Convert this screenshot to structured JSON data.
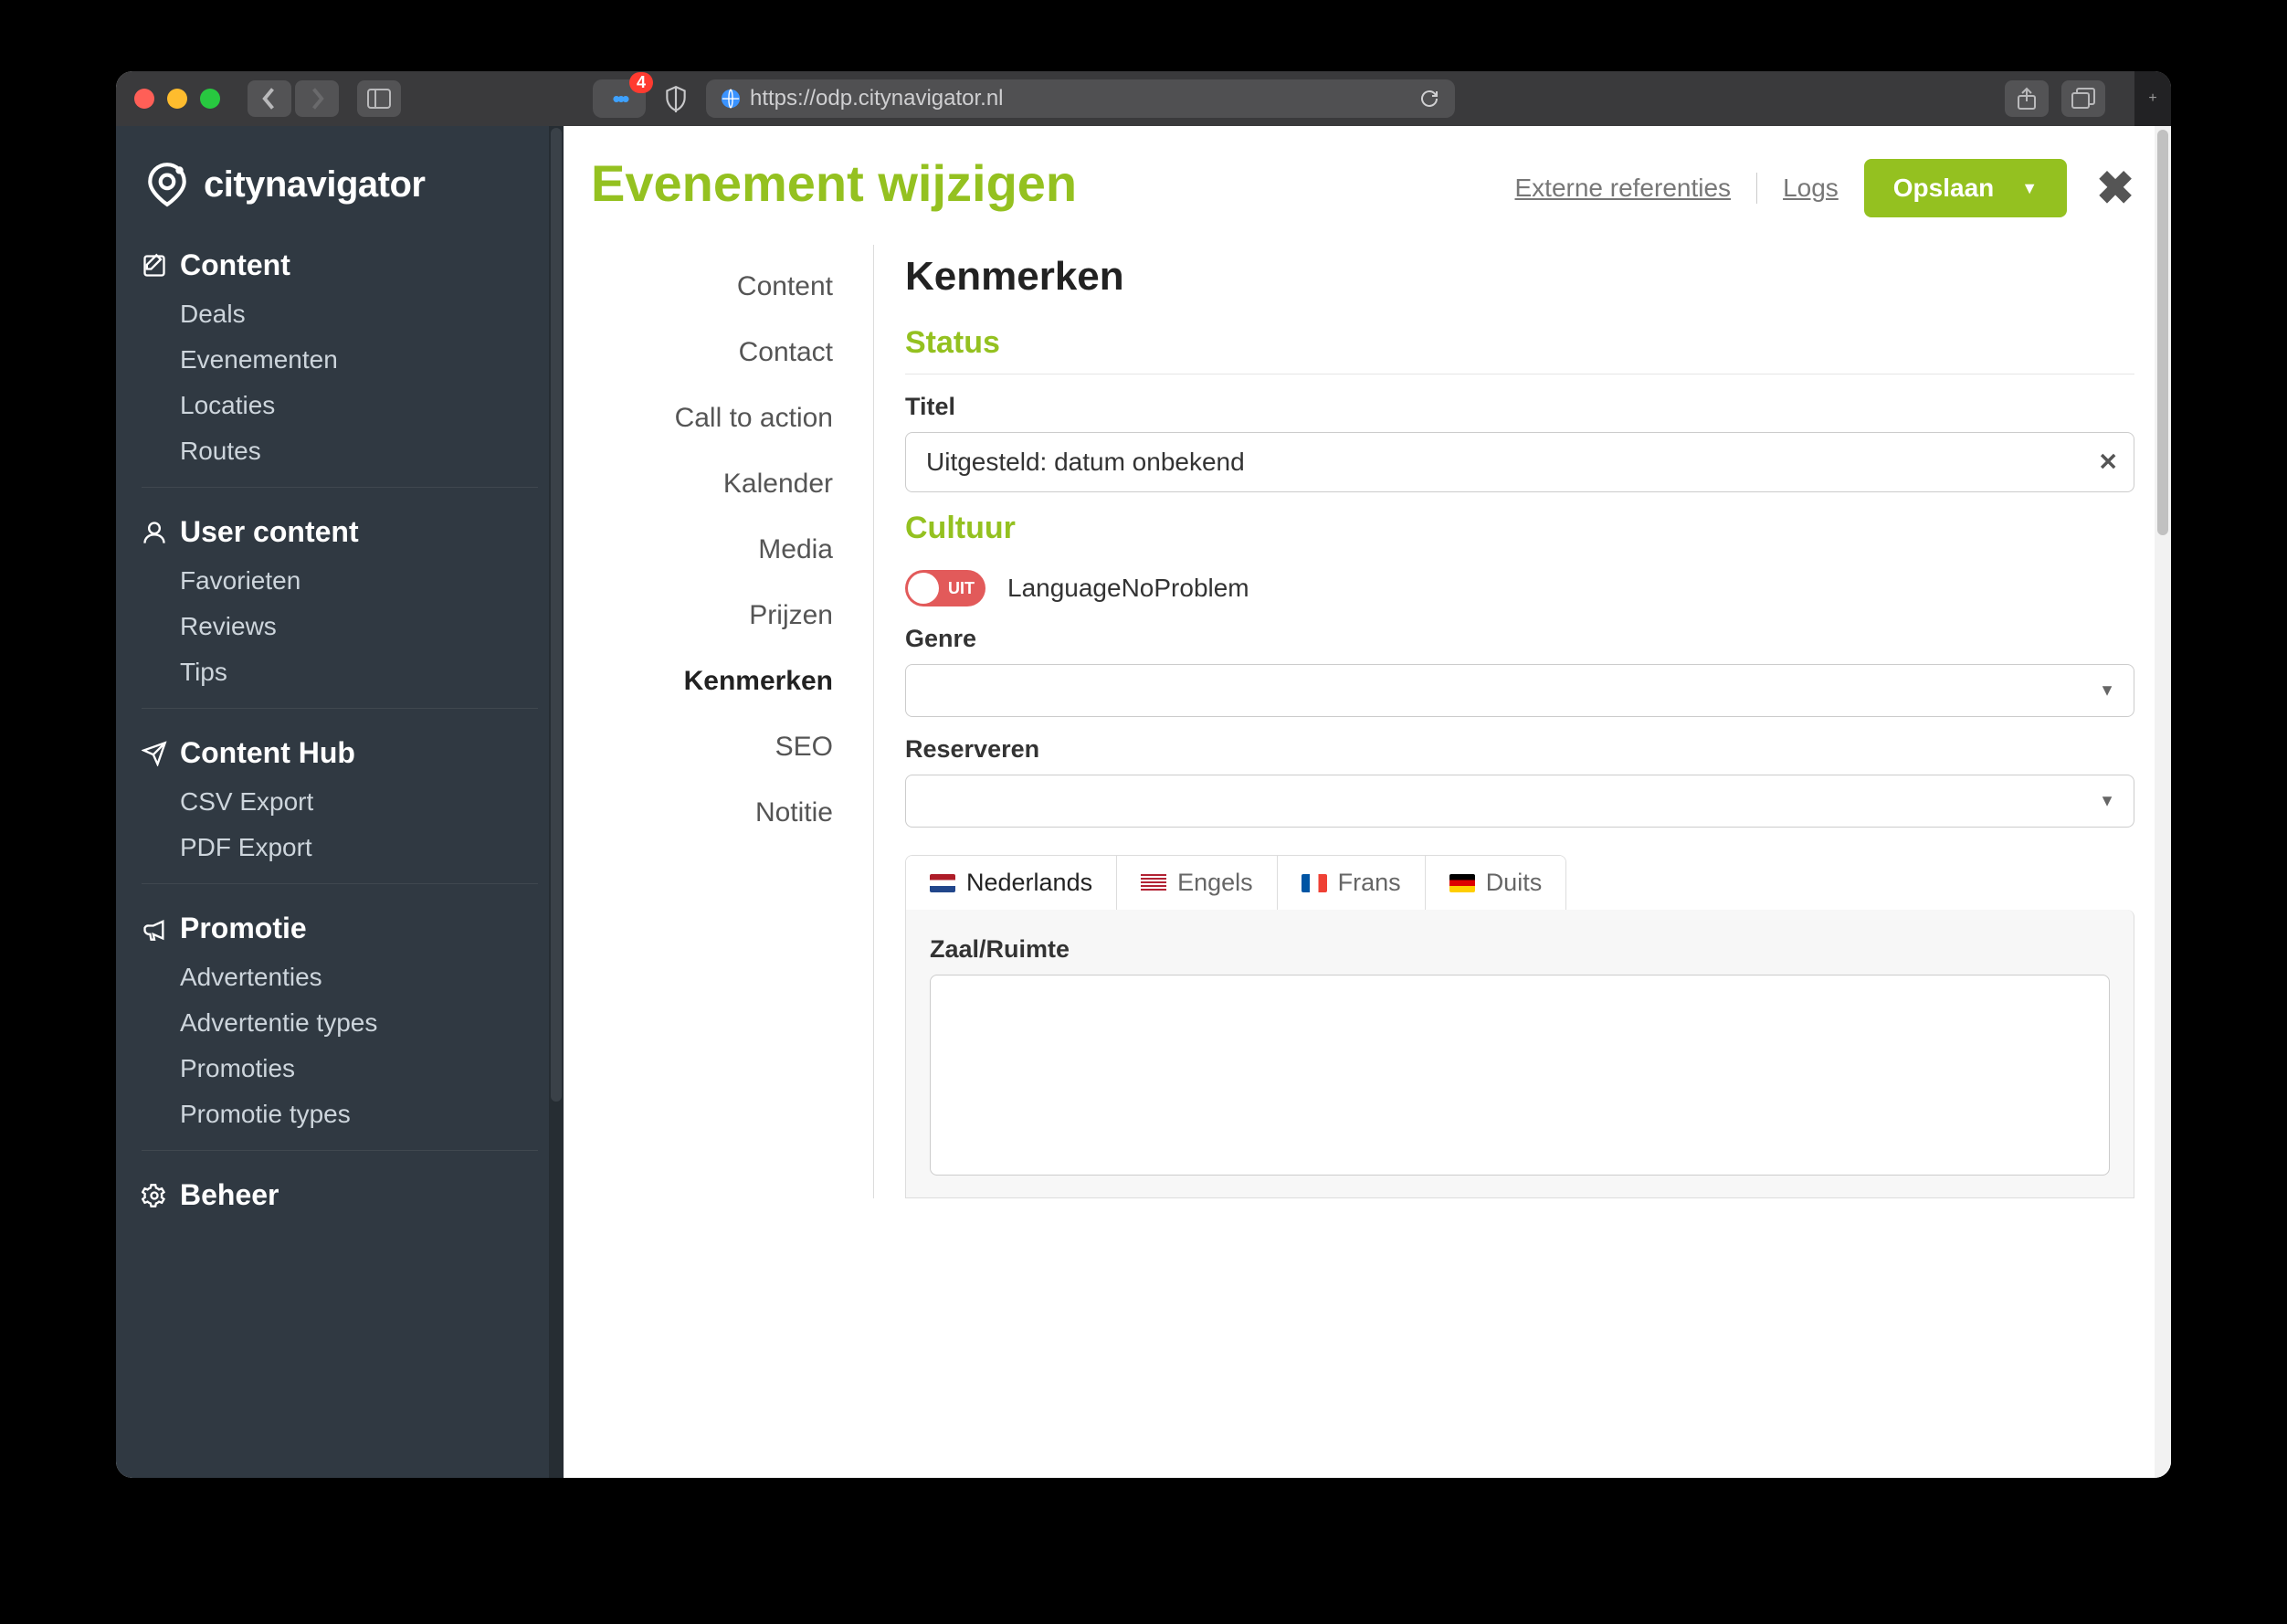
{
  "browser": {
    "url": "https://odp.citynavigator.nl",
    "badge": "4"
  },
  "brand": "citynavigator",
  "sidebar": [
    {
      "head": "Content",
      "icon": "edit",
      "items": [
        "Deals",
        "Evenementen",
        "Locaties",
        "Routes"
      ]
    },
    {
      "head": "User content",
      "icon": "user",
      "items": [
        "Favorieten",
        "Reviews",
        "Tips"
      ]
    },
    {
      "head": "Content Hub",
      "icon": "plane",
      "items": [
        "CSV Export",
        "PDF Export"
      ]
    },
    {
      "head": "Promotie",
      "icon": "bullhorn",
      "items": [
        "Advertenties",
        "Advertentie types",
        "Promoties",
        "Promotie types"
      ]
    },
    {
      "head": "Beheer",
      "icon": "gear",
      "items": []
    }
  ],
  "page": {
    "title": "Evenement wijzigen",
    "links": {
      "externe": "Externe referenties",
      "logs": "Logs"
    },
    "save": "Opslaan"
  },
  "worknav": [
    "Content",
    "Contact",
    "Call to action",
    "Kalender",
    "Media",
    "Prijzen",
    "Kenmerken",
    "SEO",
    "Notitie"
  ],
  "worknav_active": "Kenmerken",
  "form": {
    "heading": "Kenmerken",
    "section_status": "Status",
    "titel_label": "Titel",
    "titel_value": "Uitgesteld: datum onbekend",
    "section_cultuur": "Cultuur",
    "toggle_state": "UIT",
    "toggle_label": "LanguageNoProblem",
    "genre_label": "Genre",
    "reserveren_label": "Reserveren",
    "lang_tabs": [
      {
        "code": "nl",
        "label": "Nederlands"
      },
      {
        "code": "en",
        "label": "Engels"
      },
      {
        "code": "fr",
        "label": "Frans"
      },
      {
        "code": "de",
        "label": "Duits"
      }
    ],
    "zaal_label": "Zaal/Ruimte"
  }
}
